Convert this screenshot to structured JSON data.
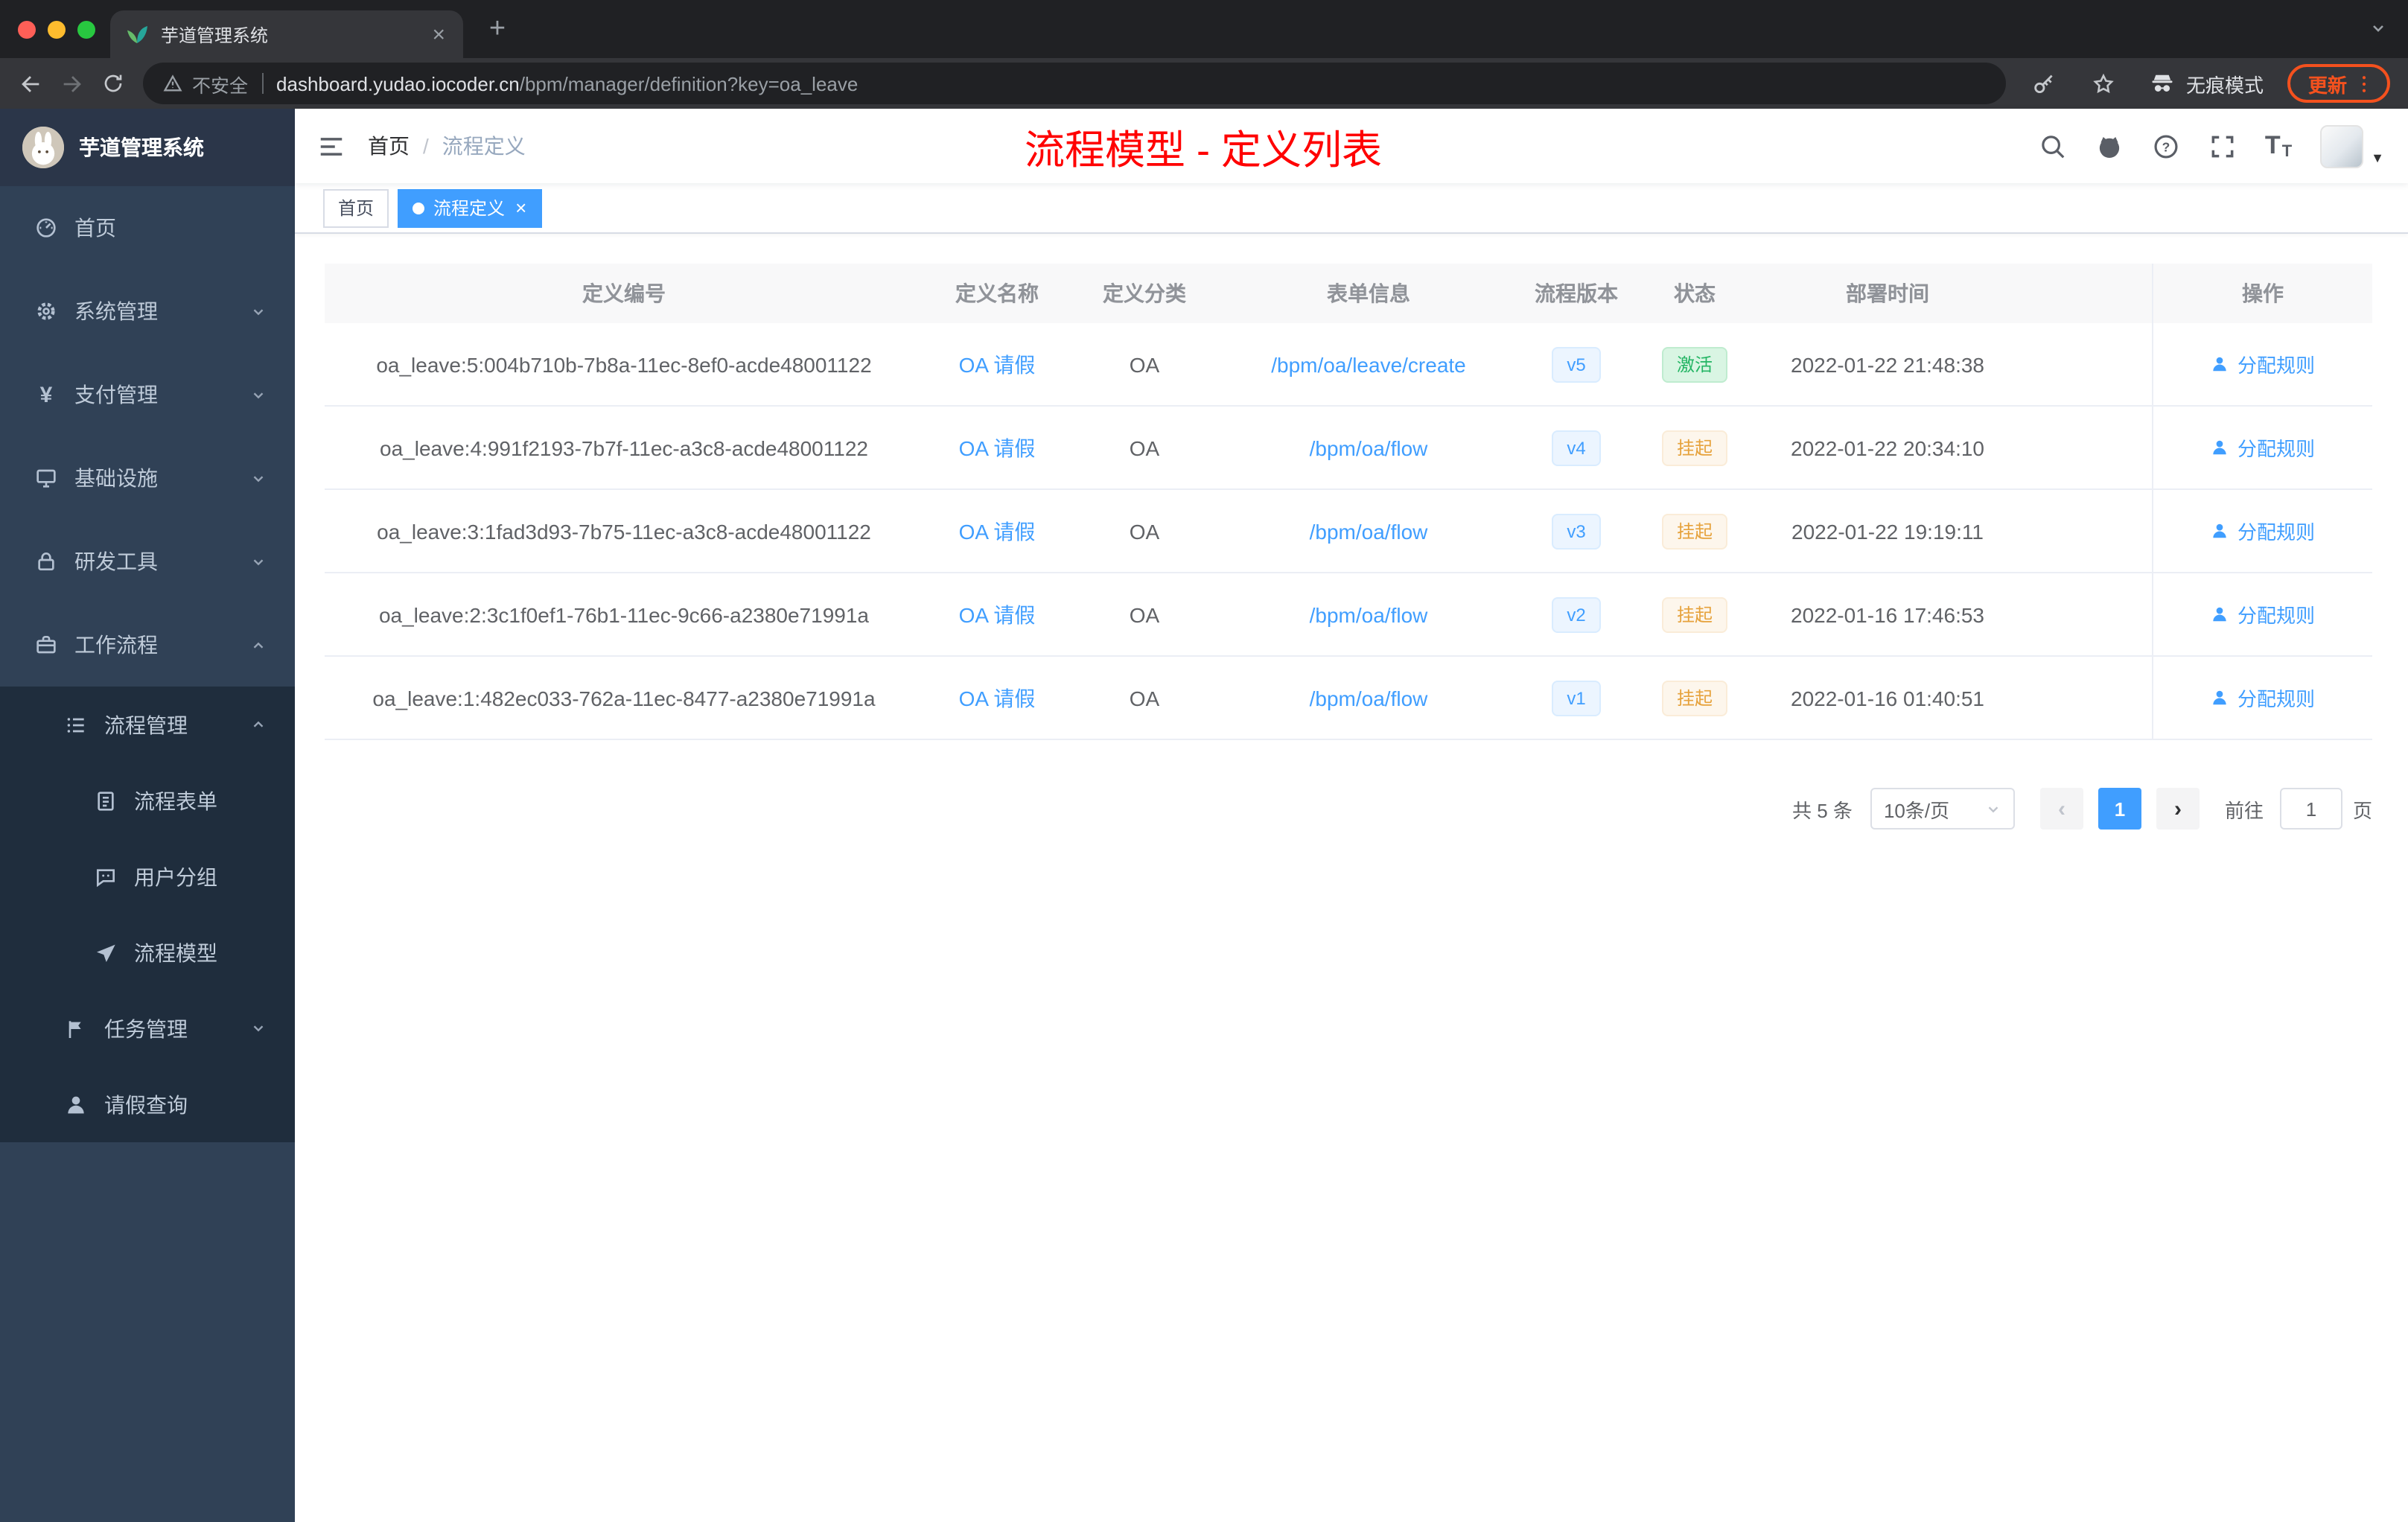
{
  "colors": {
    "primary": "#409eff",
    "page_title_red": "#ff0000",
    "status_success": "#24b564",
    "status_warning": "#e6a23c",
    "update_orange": "#f4511e",
    "sidebar_bg": "#304156",
    "sidebar_submenu_bg": "#1f2d3d"
  },
  "browser": {
    "tab_title": "芋道管理系统",
    "security_label": "不安全",
    "url_host": "dashboard.yudao.iocoder.cn",
    "url_path": "/bpm/manager/definition?key=oa_leave",
    "incognito_label": "无痕模式",
    "update_label": "更新"
  },
  "sidebar": {
    "logo_title": "芋道管理系统",
    "items": [
      {
        "label": "首页"
      },
      {
        "label": "系统管理"
      },
      {
        "label": "支付管理"
      },
      {
        "label": "基础设施"
      },
      {
        "label": "研发工具"
      },
      {
        "label": "工作流程"
      },
      {
        "label": "流程管理"
      },
      {
        "label": "流程表单"
      },
      {
        "label": "用户分组"
      },
      {
        "label": "流程模型"
      },
      {
        "label": "任务管理"
      },
      {
        "label": "请假查询"
      }
    ]
  },
  "header": {
    "breadcrumb_home": "首页",
    "breadcrumb_current": "流程定义",
    "page_title": "流程模型 - 定义列表"
  },
  "tags": {
    "home": "首页",
    "active": "流程定义"
  },
  "table": {
    "headers": [
      "定义编号",
      "定义名称",
      "定义分类",
      "表单信息",
      "流程版本",
      "状态",
      "部署时间",
      "操作"
    ],
    "rows": [
      {
        "id": "oa_leave:5:004b710b-7b8a-11ec-8ef0-acde48001122",
        "name": "OA 请假",
        "category": "OA",
        "form": "/bpm/oa/leave/create",
        "version": "v5",
        "status": "激活",
        "time": "2022-01-22 21:48:38",
        "action": "分配规则"
      },
      {
        "id": "oa_leave:4:991f2193-7b7f-11ec-a3c8-acde48001122",
        "name": "OA 请假",
        "category": "OA",
        "form": "/bpm/oa/flow",
        "version": "v4",
        "status": "挂起",
        "time": "2022-01-22 20:34:10",
        "action": "分配规则"
      },
      {
        "id": "oa_leave:3:1fad3d93-7b75-11ec-a3c8-acde48001122",
        "name": "OA 请假",
        "category": "OA",
        "form": "/bpm/oa/flow",
        "version": "v3",
        "status": "挂起",
        "time": "2022-01-22 19:19:11",
        "action": "分配规则"
      },
      {
        "id": "oa_leave:2:3c1f0ef1-76b1-11ec-9c66-a2380e71991a",
        "name": "OA 请假",
        "category": "OA",
        "form": "/bpm/oa/flow",
        "version": "v2",
        "status": "挂起",
        "time": "2022-01-16 17:46:53",
        "action": "分配规则"
      },
      {
        "id": "oa_leave:1:482ec033-762a-11ec-8477-a2380e71991a",
        "name": "OA 请假",
        "category": "OA",
        "form": "/bpm/oa/flow",
        "version": "v1",
        "status": "挂起",
        "time": "2022-01-16 01:40:51",
        "action": "分配规则"
      }
    ]
  },
  "pagination": {
    "total": "共 5 条",
    "page_size": "10条/页",
    "current_page": "1",
    "goto_label": "前往",
    "goto_value": "1",
    "page_unit": "页"
  }
}
